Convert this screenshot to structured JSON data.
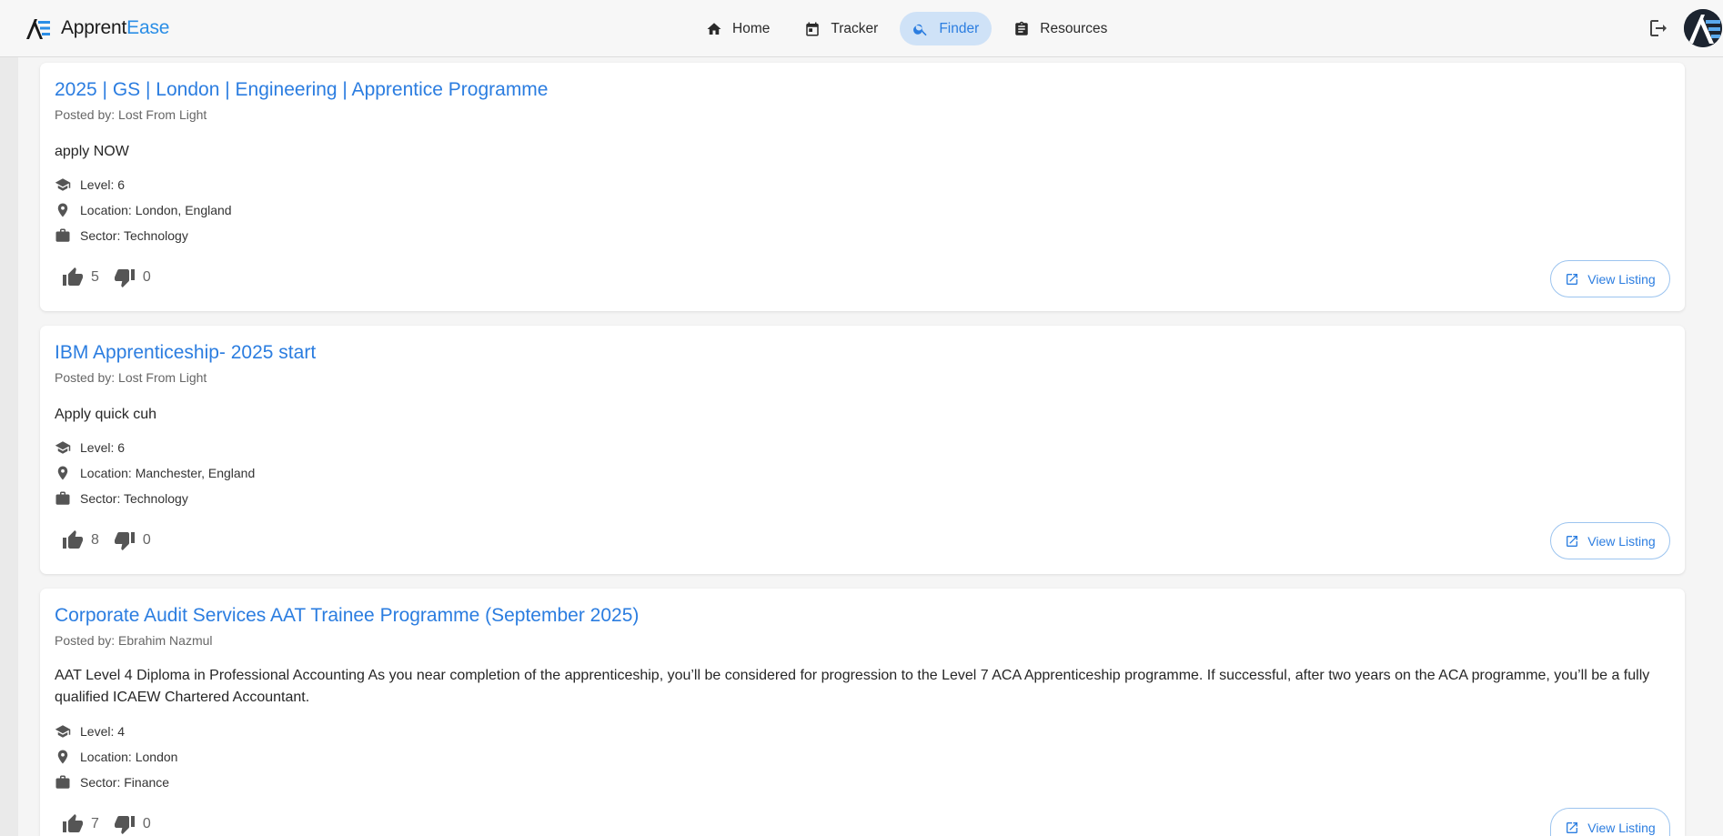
{
  "brand": {
    "name_prefix": "Apprent",
    "name_suffix": "Ease",
    "accent": "#2b8ee6"
  },
  "nav": [
    {
      "label": "Home",
      "icon": "home-icon",
      "active": false
    },
    {
      "label": "Tracker",
      "icon": "calendar-icon",
      "active": false
    },
    {
      "label": "Finder",
      "icon": "search-icon",
      "active": true
    },
    {
      "label": "Resources",
      "icon": "clipboard-icon",
      "active": false
    }
  ],
  "header_actions": {
    "logout_icon": "logout-icon",
    "avatar_icon": "avatar-logo"
  },
  "listings": [
    {
      "title": "2025 | GS | London | Engineering | Apprentice Programme",
      "posted_by": "Posted by: Lost From Light",
      "description": "apply NOW",
      "level": "Level: 6",
      "location": "Location: London, England",
      "sector": "Sector: Technology",
      "upvotes": "5",
      "downvotes": "0",
      "button": "View Listing"
    },
    {
      "title": "IBM Apprenticeship- 2025 start",
      "posted_by": "Posted by: Lost From Light",
      "description": "Apply quick cuh",
      "level": "Level: 6",
      "location": "Location: Manchester, England",
      "sector": "Sector: Technology",
      "upvotes": "8",
      "downvotes": "0",
      "button": "View Listing"
    },
    {
      "title": "Corporate Audit Services AAT Trainee Programme (September 2025)",
      "posted_by": "Posted by: Ebrahim Nazmul",
      "description": "AAT Level 4 Diploma in Professional Accounting As you near completion of the apprenticeship, you’ll be considered for progression to the Level 7 ACA Apprenticeship programme. If successful, after two years on the ACA programme, you’ll be a fully qualified ICAEW Chartered Accountant.",
      "level": "Level: 4",
      "location": "Location: London",
      "sector": "Sector: Finance",
      "upvotes": "7",
      "downvotes": "0",
      "button": "View Listing"
    }
  ],
  "colors": {
    "link": "#2b7de0",
    "active_nav_bg": "#cfe2f7",
    "icon": "#555555"
  }
}
